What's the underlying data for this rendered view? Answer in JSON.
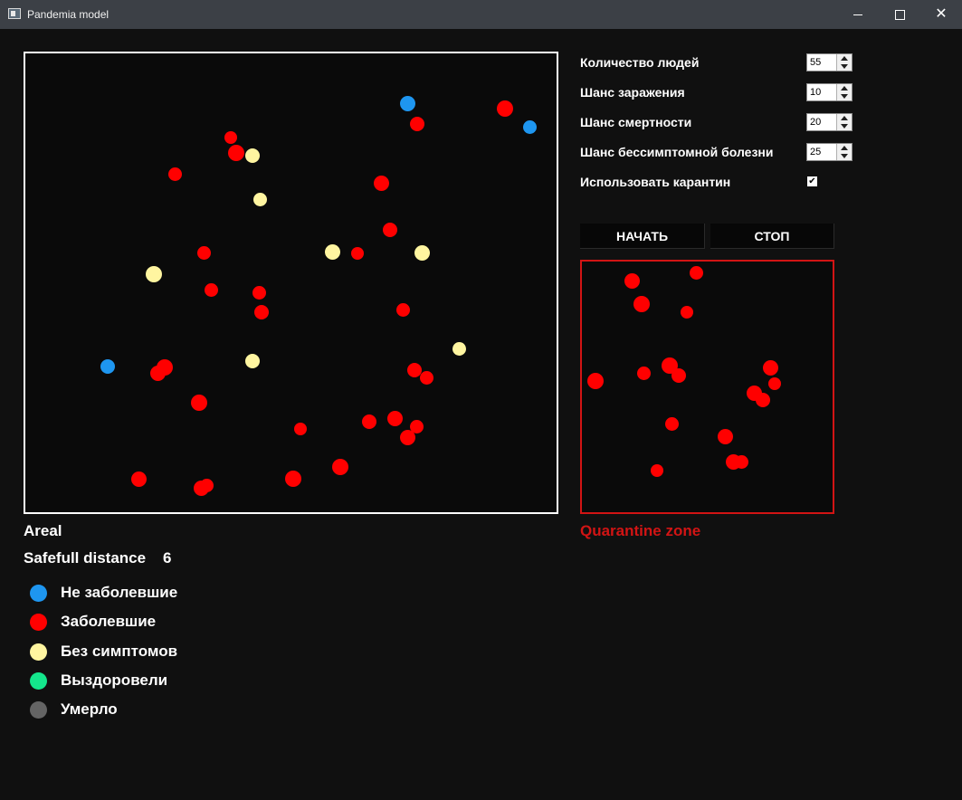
{
  "window": {
    "title": "Pandemia model"
  },
  "colors": {
    "healthy": "#1e96f0",
    "infected": "#ff0000",
    "asymptomatic": "#fff5a0",
    "recovered": "#14e68c",
    "dead": "#646464",
    "quarantine_border": "#d21414"
  },
  "settings": {
    "people_count_label": "Количество людей",
    "people_count": "55",
    "infection_chance_label": "Шанс заражения",
    "infection_chance": "10",
    "death_chance_label": "Шанс смертности",
    "death_chance": "20",
    "asymptomatic_chance_label": "Шанс бессимптомной болезни",
    "asymptomatic_chance": "25",
    "quarantine_label": "Использовать карантин",
    "quarantine_checked": true
  },
  "buttons": {
    "start": "НАЧАТЬ",
    "stop": "СТОП"
  },
  "areal": {
    "label": "Areal",
    "safe_distance_label": "Safefull distance",
    "safe_distance": "6"
  },
  "quarantine_zone": {
    "label": "Quarantine zone"
  },
  "legend": [
    {
      "label": "Не заболевшие",
      "state": "healthy"
    },
    {
      "label": "Заболевшие",
      "state": "infected"
    },
    {
      "label": "Без симптомов",
      "state": "asymptomatic"
    },
    {
      "label": "Выздоровели",
      "state": "recovered"
    },
    {
      "label": "Умерло",
      "state": "dead"
    }
  ]
}
